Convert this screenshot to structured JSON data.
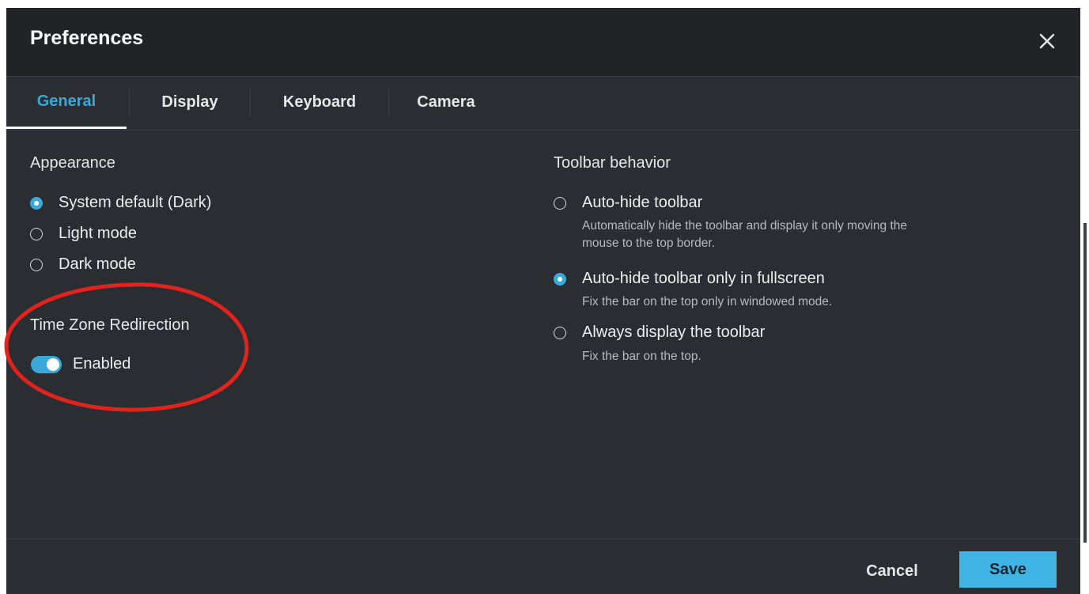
{
  "dialog": {
    "title": "Preferences",
    "close_icon": "close-icon"
  },
  "tabs": [
    {
      "label": "General",
      "active": true
    },
    {
      "label": "Display",
      "active": false
    },
    {
      "label": "Keyboard",
      "active": false
    },
    {
      "label": "Camera",
      "active": false
    }
  ],
  "appearance": {
    "title": "Appearance",
    "options": [
      {
        "label": "System default (Dark)",
        "checked": true
      },
      {
        "label": "Light mode",
        "checked": false
      },
      {
        "label": "Dark mode",
        "checked": false
      }
    ]
  },
  "time_zone": {
    "title": "Time Zone Redirection",
    "toggle_label": "Enabled",
    "toggle_on": true
  },
  "toolbar": {
    "title": "Toolbar behavior",
    "options": [
      {
        "label": "Auto-hide toolbar",
        "checked": false,
        "desc_line1": "Automatically hide the toolbar and display it only moving the",
        "desc_line2": "mouse to the top border."
      },
      {
        "label": "Auto-hide toolbar only in fullscreen",
        "checked": true,
        "desc_line1": "Fix the bar on the top only in windowed mode."
      },
      {
        "label": "Always display the toolbar",
        "checked": false,
        "desc_line1": "Fix the bar on the top."
      }
    ]
  },
  "footer": {
    "cancel_label": "Cancel",
    "save_label": "Save"
  },
  "colors": {
    "accent": "#3aa9d8",
    "save_button": "#3fb4e5",
    "dialog_bg": "#2a2d31",
    "header_bg": "#212327",
    "annotation_ellipse": "#e0231c"
  }
}
